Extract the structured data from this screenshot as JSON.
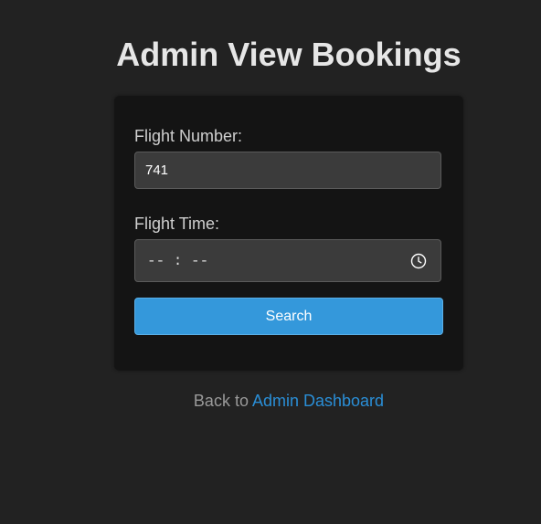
{
  "page": {
    "title": "Admin View Bookings"
  },
  "form": {
    "flight_number_label": "Flight Number:",
    "flight_number_value": "741",
    "flight_time_label": "Flight Time:",
    "flight_time_placeholder": "-- : --",
    "time_icon": "clock-icon",
    "search_label": "Search"
  },
  "footer": {
    "back_prefix": "Back to",
    "back_link_label": "Admin Dashboard"
  },
  "colors": {
    "background": "#222222",
    "card": "#141414",
    "input": "#3b3b3b",
    "button": "#3498db",
    "link": "#2a8ed6"
  }
}
